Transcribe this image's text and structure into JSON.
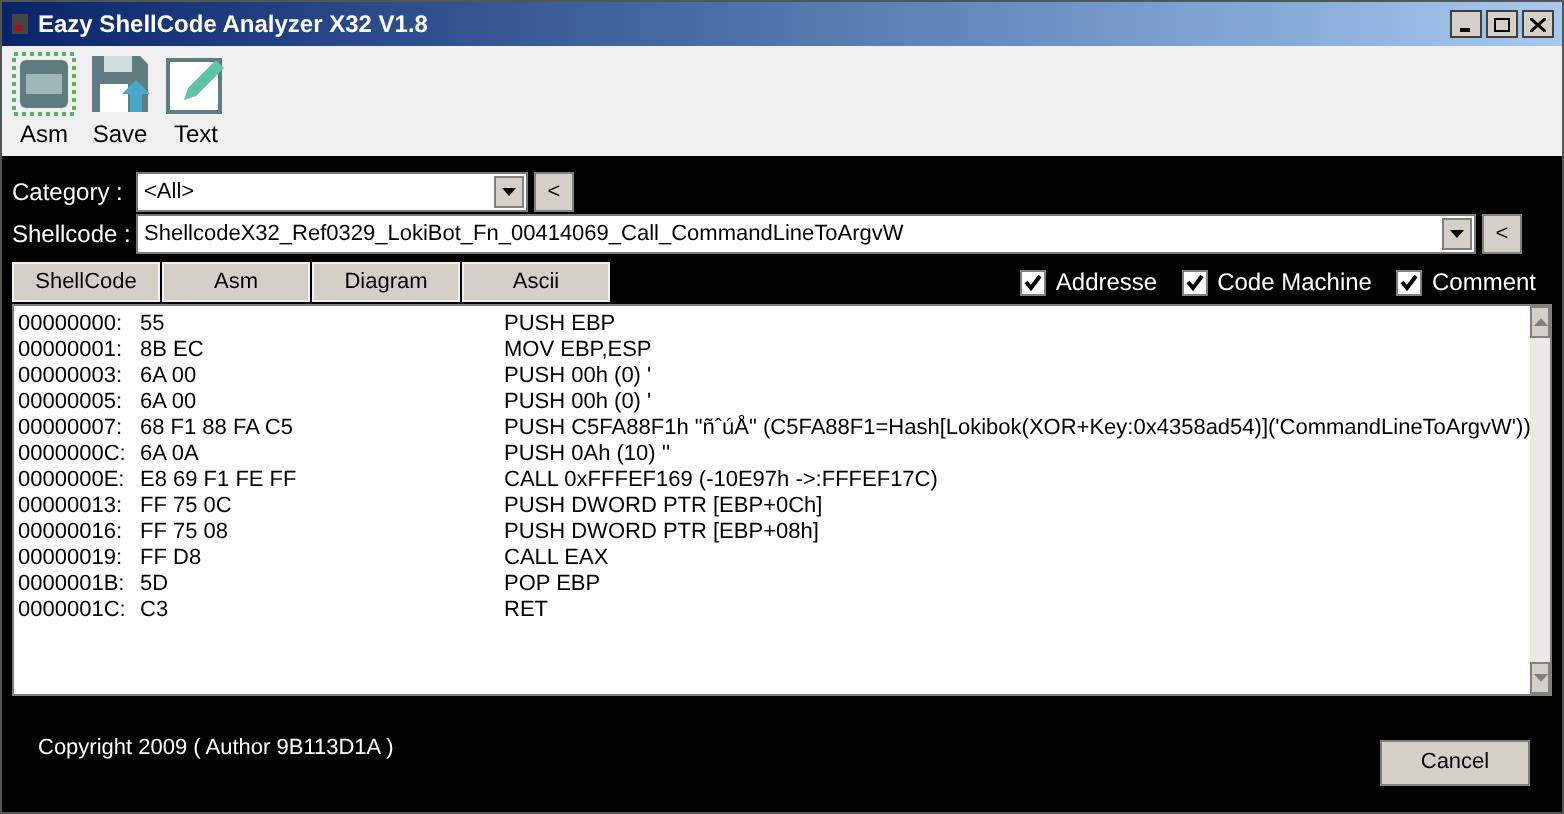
{
  "window": {
    "title": "Eazy ShellCode Analyzer X32 V1.8"
  },
  "toolbar": [
    {
      "kind": "asm",
      "label": "Asm"
    },
    {
      "kind": "save",
      "label": "Save"
    },
    {
      "kind": "text",
      "label": "Text"
    }
  ],
  "category": {
    "label": "Category :",
    "value": "<All>",
    "back": "<"
  },
  "shellcode": {
    "label": "Shellcode :",
    "value": "ShellcodeX32_Ref0329_LokiBot_Fn_00414069_Call_CommandLineToArgvW",
    "back": "<"
  },
  "view_buttons": [
    "ShellCode",
    "Asm",
    "Diagram",
    "Ascii"
  ],
  "options": [
    {
      "label": "Addresse",
      "checked": true
    },
    {
      "label": "Code Machine",
      "checked": true
    },
    {
      "label": "Comment",
      "checked": true
    }
  ],
  "listing": [
    {
      "address": "00000000:",
      "bytes": "55",
      "instruction": "PUSH EBP"
    },
    {
      "address": "00000001:",
      "bytes": "8B EC",
      "instruction": "MOV EBP,ESP"
    },
    {
      "address": "00000003:",
      "bytes": "6A 00",
      "instruction": "PUSH 00h (0) '"
    },
    {
      "address": "00000005:",
      "bytes": "6A 00",
      "instruction": "PUSH 00h (0) '"
    },
    {
      "address": "00000007:",
      "bytes": "68 F1 88 FA C5",
      "instruction": "PUSH C5FA88F1h \"ñˆúÅ\" (C5FA88F1=Hash[Lokibok(XOR+Key:0x4358ad54)]('CommandLineToArgvW'))"
    },
    {
      "address": "0000000C:",
      "bytes": "6A 0A",
      "instruction": "PUSH 0Ah (10) ''"
    },
    {
      "address": "0000000E:",
      "bytes": "E8 69 F1 FE FF",
      "instruction": "CALL 0xFFFEF169 (-10E97h ->:FFFEF17C)"
    },
    {
      "address": "00000013:",
      "bytes": "FF 75 0C",
      "instruction": "PUSH DWORD PTR [EBP+0Ch]"
    },
    {
      "address": "00000016:",
      "bytes": "FF 75 08",
      "instruction": "PUSH DWORD PTR [EBP+08h]"
    },
    {
      "address": "00000019:",
      "bytes": "FF D8",
      "instruction": "CALL EAX"
    },
    {
      "address": "0000001B:",
      "bytes": "5D",
      "instruction": "POP EBP"
    },
    {
      "address": "0000001C:",
      "bytes": "C3",
      "instruction": "RET"
    }
  ],
  "footer": {
    "copyright": "Copyright 2009 ( Author 9B113D1A )",
    "cancel": "Cancel"
  }
}
